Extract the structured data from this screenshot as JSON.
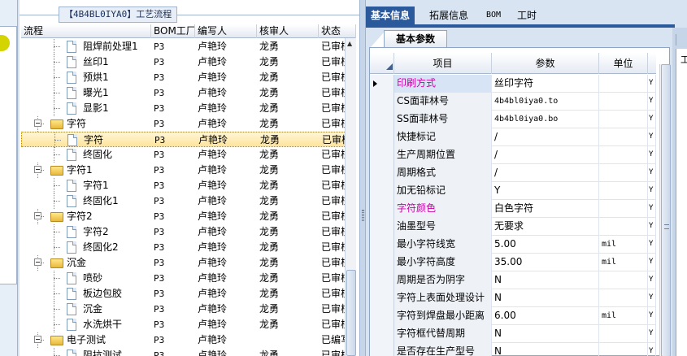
{
  "tree": {
    "title": "【4B4BL0IYA0】工艺流程",
    "columns": [
      "流程",
      "BOM工厂",
      "编写人",
      "核审人",
      "状态"
    ],
    "rows": [
      {
        "name": "阻焊前处理1",
        "bom": "P3",
        "writer": "卢艳玲",
        "reviewer": "龙勇",
        "status": "已审核",
        "kind": "doc"
      },
      {
        "name": "丝印1",
        "bom": "P3",
        "writer": "卢艳玲",
        "reviewer": "龙勇",
        "status": "已审核",
        "kind": "doc"
      },
      {
        "name": "预烘1",
        "bom": "P3",
        "writer": "卢艳玲",
        "reviewer": "龙勇",
        "status": "已审核",
        "kind": "doc"
      },
      {
        "name": "曝光1",
        "bom": "P3",
        "writer": "卢艳玲",
        "reviewer": "龙勇",
        "status": "已审核",
        "kind": "doc"
      },
      {
        "name": "显影1",
        "bom": "P3",
        "writer": "卢艳玲",
        "reviewer": "龙勇",
        "status": "已审核",
        "kind": "doc"
      },
      {
        "name": "字符",
        "bom": "P3",
        "writer": "卢艳玲",
        "reviewer": "龙勇",
        "status": "已审核",
        "kind": "folder"
      },
      {
        "name": "字符",
        "bom": "P3",
        "writer": "卢艳玲",
        "reviewer": "龙勇",
        "status": "已审核",
        "kind": "doc",
        "selected": true
      },
      {
        "name": "终固化",
        "bom": "P3",
        "writer": "卢艳玲",
        "reviewer": "龙勇",
        "status": "已审核",
        "kind": "doc"
      },
      {
        "name": "字符1",
        "bom": "P3",
        "writer": "卢艳玲",
        "reviewer": "龙勇",
        "status": "已审核",
        "kind": "folder"
      },
      {
        "name": "字符1",
        "bom": "P3",
        "writer": "卢艳玲",
        "reviewer": "龙勇",
        "status": "已审核",
        "kind": "doc"
      },
      {
        "name": "终固化1",
        "bom": "P3",
        "writer": "卢艳玲",
        "reviewer": "龙勇",
        "status": "已审核",
        "kind": "doc"
      },
      {
        "name": "字符2",
        "bom": "P3",
        "writer": "卢艳玲",
        "reviewer": "龙勇",
        "status": "已审核",
        "kind": "folder"
      },
      {
        "name": "字符2",
        "bom": "P3",
        "writer": "卢艳玲",
        "reviewer": "龙勇",
        "status": "已审核",
        "kind": "doc"
      },
      {
        "name": "终固化2",
        "bom": "P3",
        "writer": "卢艳玲",
        "reviewer": "龙勇",
        "status": "已审核",
        "kind": "doc"
      },
      {
        "name": "沉金",
        "bom": "P3",
        "writer": "卢艳玲",
        "reviewer": "龙勇",
        "status": "已审核",
        "kind": "folder"
      },
      {
        "name": "喷砂",
        "bom": "P3",
        "writer": "卢艳玲",
        "reviewer": "龙勇",
        "status": "已审核",
        "kind": "doc"
      },
      {
        "name": "板边包胶",
        "bom": "P3",
        "writer": "卢艳玲",
        "reviewer": "龙勇",
        "status": "已审核",
        "kind": "doc"
      },
      {
        "name": "沉金",
        "bom": "P3",
        "writer": "卢艳玲",
        "reviewer": "龙勇",
        "status": "已审核",
        "kind": "doc"
      },
      {
        "name": "水洗烘干",
        "bom": "P3",
        "writer": "卢艳玲",
        "reviewer": "龙勇",
        "status": "已审核",
        "kind": "doc"
      },
      {
        "name": "电子测试",
        "bom": "P3",
        "writer": "卢艳玲",
        "reviewer": "",
        "status": "已编写",
        "kind": "folder"
      },
      {
        "name": "阻抗测试",
        "bom": "P3",
        "writer": "卢艳玲",
        "reviewer": "龙勇",
        "status": "已审核",
        "kind": "doc"
      }
    ]
  },
  "tabs": [
    "基本信息",
    "拓展信息",
    "BOM",
    "工时"
  ],
  "active_tab": "基本信息",
  "subtab": "基本参数",
  "right_edge_label": "工",
  "grid": {
    "columns": [
      "项目",
      "参数",
      "单位"
    ],
    "rows": [
      {
        "item": "印刷方式",
        "param": "丝印字符",
        "unit": "",
        "flag": "Y",
        "pink": true,
        "current": true,
        "highlight": true
      },
      {
        "item": "CS面菲林号",
        "param": "4b4bl0iya0.to",
        "unit": "",
        "flag": "Y",
        "mono": true
      },
      {
        "item": "SS面菲林号",
        "param": "4b4bl0iya0.bo",
        "unit": "",
        "flag": "Y",
        "mono": true
      },
      {
        "item": "快捷标记",
        "param": "/",
        "unit": "",
        "flag": "Y"
      },
      {
        "item": "生产周期位置",
        "param": "/",
        "unit": "",
        "flag": "Y"
      },
      {
        "item": "周期格式",
        "param": "/",
        "unit": "",
        "flag": "Y"
      },
      {
        "item": "加无铅标记",
        "param": "Y",
        "unit": "",
        "flag": "Y"
      },
      {
        "item": "字符颜色",
        "param": "白色字符",
        "unit": "",
        "flag": "Y",
        "pink": true
      },
      {
        "item": "油墨型号",
        "param": "无要求",
        "unit": "",
        "flag": "Y"
      },
      {
        "item": "最小字符线宽",
        "param": "5.00",
        "unit": "mil",
        "flag": "Y"
      },
      {
        "item": "最小字符高度",
        "param": "35.00",
        "unit": "mil",
        "flag": "Y"
      },
      {
        "item": "周期是否为阴字",
        "param": "N",
        "unit": "",
        "flag": "Y"
      },
      {
        "item": "字符上表面处理设计",
        "param": "N",
        "unit": "",
        "flag": "Y"
      },
      {
        "item": "字符到焊盘最小距离",
        "param": "6.00",
        "unit": "mil",
        "flag": "Y"
      },
      {
        "item": "字符框代替周期",
        "param": "N",
        "unit": "",
        "flag": "Y"
      },
      {
        "item": "是否存在生产型号",
        "param": "N",
        "unit": "",
        "flag": "Y"
      }
    ]
  },
  "colors": {
    "accent": "#2b5a9c",
    "pink_label": "#cc00aa",
    "selected_row": "#ffe49a"
  }
}
